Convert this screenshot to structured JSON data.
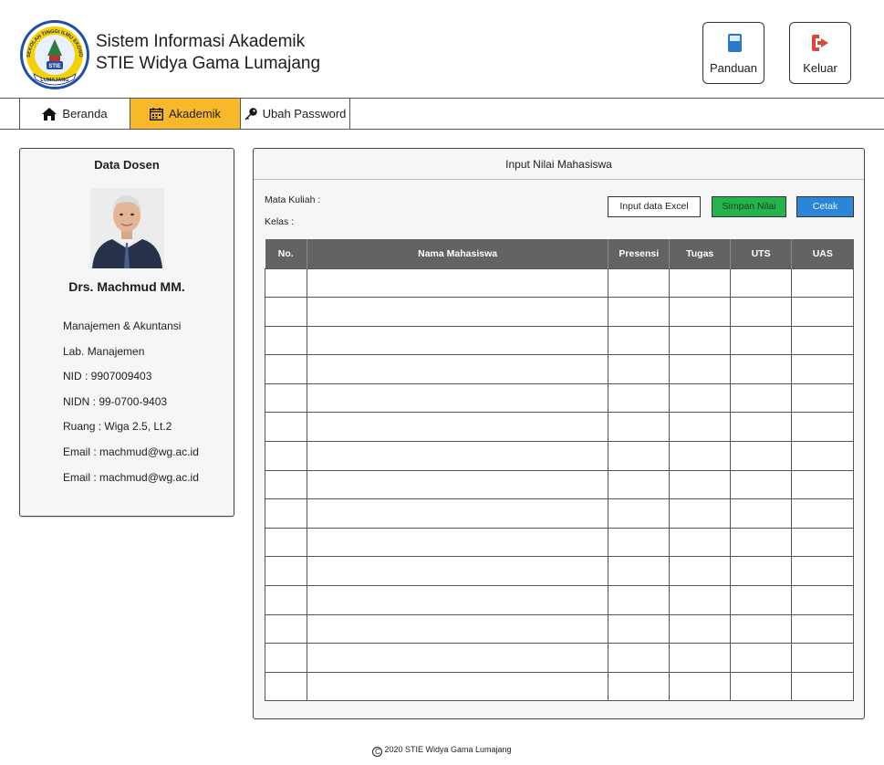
{
  "app": {
    "title_line1": "Sistem Informasi Akademik",
    "title_line2": "STIE Widya Gama Lumajang",
    "logo": {
      "ring_text": "SEKOLAH TINGGI ILMU EKONOMI WIDYA GAMA",
      "center_text": "STIE",
      "bottom_text": "LUMAJANG"
    }
  },
  "header_actions": [
    {
      "label": "Panduan",
      "icon": "book-icon"
    },
    {
      "label": "Keluar",
      "icon": "logout-icon"
    }
  ],
  "nav": [
    {
      "label": "Beranda",
      "icon": "home-icon",
      "active": false
    },
    {
      "label": "Akademik",
      "icon": "calendar-icon",
      "active": true
    },
    {
      "label": "Ubah Password",
      "icon": "key-icon",
      "active": false
    }
  ],
  "lecturer": {
    "card_title": "Data Dosen",
    "name": "Drs. Machmud MM.",
    "details": [
      "Manajemen & Akuntansi",
      "Lab. Manajemen",
      "NID : 9907009403",
      "NIDN : 99-0700-9403",
      "Ruang : Wiga 2.5, Lt.2",
      "Email : machmud@wg.ac.id",
      "Email : machmud@wg.ac.id"
    ]
  },
  "grade_input": {
    "title": "Input Nilai Mahasiswa",
    "mata_kuliah_label": "Mata Kuliah :",
    "kelas_label": "Kelas :",
    "buttons": {
      "excel": "Input data Excel",
      "save": "Simpan Nilai",
      "print": "Cetak"
    },
    "columns": [
      "No.",
      "Nama Mahasiswa",
      "Presensi",
      "Tugas",
      "UTS",
      "UAS"
    ],
    "row_count": 15
  },
  "colors": {
    "nav_active": "#f7b92a",
    "save": "#25b34b",
    "print": "#2b86d8",
    "table_header": "#636363",
    "logout_icon": "#e0453a",
    "book_icon": "#2a78c8"
  },
  "footer": {
    "text": "2020 STIE Widya Gama Lumajang"
  }
}
